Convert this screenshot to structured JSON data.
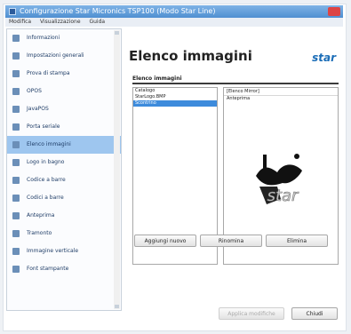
{
  "window": {
    "title": "Configurazione Star Micronics TSP100 (Modo Star Line)"
  },
  "menu": {
    "items": [
      "Modifica",
      "Visualizzazione",
      "Guida"
    ]
  },
  "sidebar": {
    "items": [
      {
        "label": "Informazioni"
      },
      {
        "label": "Impostazioni generali"
      },
      {
        "label": "Prova di stampa"
      },
      {
        "label": "OPOS"
      },
      {
        "label": "JavaPOS"
      },
      {
        "label": "Porta seriale"
      },
      {
        "label": "Elenco immagini"
      },
      {
        "label": "Logo in bagno"
      },
      {
        "label": "Codice a barre"
      },
      {
        "label": "Codici a barre"
      },
      {
        "label": "Anteprima"
      },
      {
        "label": "Tramonto"
      },
      {
        "label": "Immagine verticale"
      },
      {
        "label": "Font stampante"
      }
    ],
    "selected_index": 6
  },
  "main": {
    "heading": "Elenco immagini",
    "logo_text": "star",
    "section_title": "Elenco immagini",
    "list_items": [
      "Catalogo",
      "StarLogo.BMP",
      "Scontrino"
    ],
    "selected_list_index": 2,
    "preview_header": "[Elenco Mirror]",
    "preview_name": "Anteprima",
    "buttons": {
      "add": "Aggiungi nuovo",
      "rename": "Rinomina",
      "delete": "Elimina"
    }
  },
  "footer": {
    "apply": "Applica modifiche",
    "close": "Chiudi"
  }
}
